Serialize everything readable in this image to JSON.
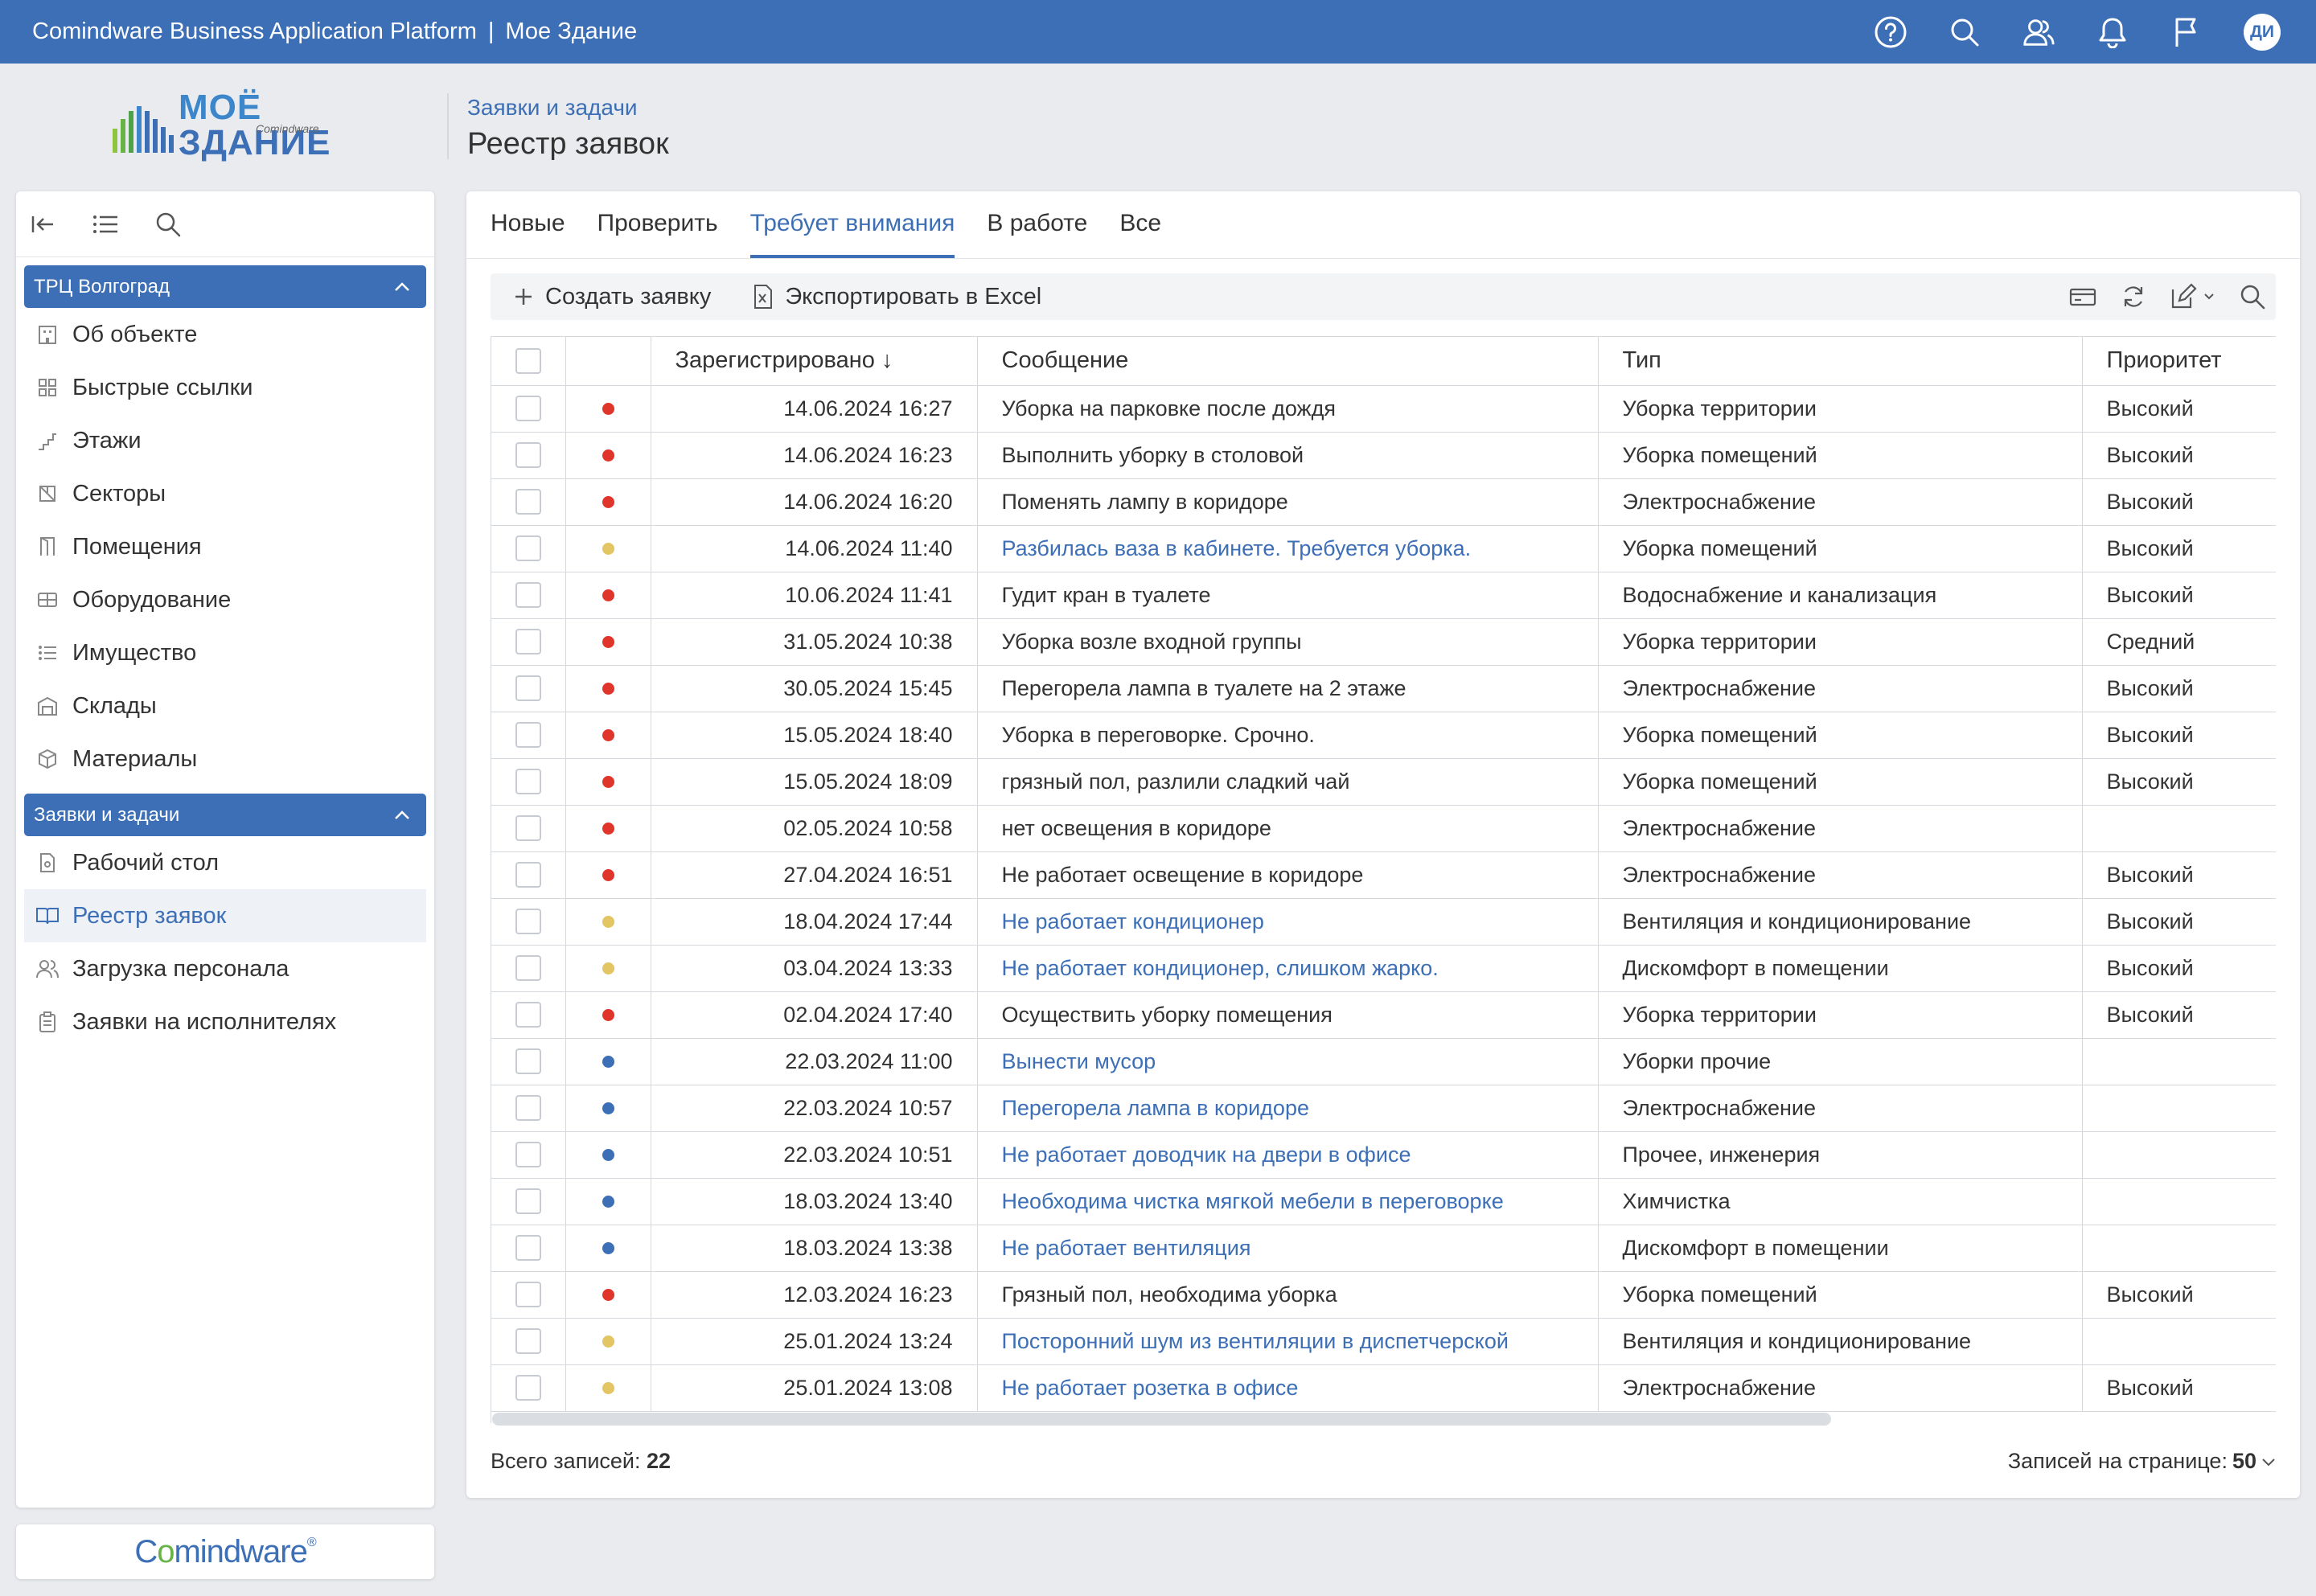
{
  "app": {
    "platform": "Comindware Business Application Platform",
    "separator": "|",
    "app_name": "Мое Здание"
  },
  "logo": {
    "line1": "МОЁ",
    "line2": "ЗДАНИЕ",
    "brand": "Comindware"
  },
  "header": {
    "breadcrumb": "Заявки и задачи",
    "title": "Реестр заявок"
  },
  "topbar": {
    "avatar_initials": "ДИ",
    "icons": [
      "help-icon",
      "search-icon",
      "users-icon",
      "bell-icon",
      "flag-icon"
    ]
  },
  "sidebar": {
    "group1": {
      "label": "ТРЦ Волгоград",
      "items": [
        {
          "label": "Об объекте",
          "icon": "building-icon"
        },
        {
          "label": "Быстрые ссылки",
          "icon": "grid-icon"
        },
        {
          "label": "Этажи",
          "icon": "stairs-icon"
        },
        {
          "label": "Секторы",
          "icon": "sectors-icon"
        },
        {
          "label": "Помещения",
          "icon": "door-icon"
        },
        {
          "label": "Оборудование",
          "icon": "equipment-icon"
        },
        {
          "label": "Имущество",
          "icon": "list-icon"
        },
        {
          "label": "Склады",
          "icon": "warehouse-icon"
        },
        {
          "label": "Материалы",
          "icon": "box-icon"
        }
      ]
    },
    "group2": {
      "label": "Заявки и задачи",
      "items": [
        {
          "label": "Рабочий стол",
          "icon": "document-icon"
        },
        {
          "label": "Реестр заявок",
          "icon": "book-icon",
          "active": true
        },
        {
          "label": "Загрузка персонала",
          "icon": "people-icon"
        },
        {
          "label": "Заявки на исполнителях",
          "icon": "clipboard-icon"
        }
      ]
    }
  },
  "footer_logo": {
    "text1": "C",
    "text2": "o",
    "text3": "mindware",
    "mark": "®"
  },
  "tabs": [
    "Новые",
    "Проверить",
    "Требует внимания",
    "В работе",
    "Все"
  ],
  "active_tab": "Требует внимания",
  "toolbar": {
    "create": "Создать заявку",
    "export": "Экспортировать в Excel"
  },
  "table": {
    "columns": [
      "",
      "",
      "Зарегистрировано ↓",
      "Сообщение",
      "Тип",
      "Приоритет"
    ],
    "rows": [
      {
        "status": "red",
        "date": "14.06.2024 16:27",
        "message": "Уборка на парковке после дождя",
        "type": "Уборка территории",
        "priority": "Высокий",
        "link": false
      },
      {
        "status": "red",
        "date": "14.06.2024 16:23",
        "message": "Выполнить уборку в столовой",
        "type": "Уборка помещений",
        "priority": "Высокий",
        "link": false
      },
      {
        "status": "red",
        "date": "14.06.2024 16:20",
        "message": "Поменять лампу в коридоре",
        "type": "Электроснабжение",
        "priority": "Высокий",
        "link": false
      },
      {
        "status": "yellow",
        "date": "14.06.2024 11:40",
        "message": "Разбилась ваза в кабинете. Требуется уборка.",
        "type": "Уборка помещений",
        "priority": "Высокий",
        "link": true
      },
      {
        "status": "red",
        "date": "10.06.2024 11:41",
        "message": "Гудит кран в туалете",
        "type": "Водоснабжение и канализация",
        "priority": "Высокий",
        "link": false
      },
      {
        "status": "red",
        "date": "31.05.2024 10:38",
        "message": "Уборка возле входной группы",
        "type": "Уборка территории",
        "priority": "Средний",
        "link": false
      },
      {
        "status": "red",
        "date": "30.05.2024 15:45",
        "message": "Перегорела лампа в туалете на 2 этаже",
        "type": "Электроснабжение",
        "priority": "Высокий",
        "link": false
      },
      {
        "status": "red",
        "date": "15.05.2024 18:40",
        "message": "Уборка в переговорке. Срочно.",
        "type": "Уборка помещений",
        "priority": "Высокий",
        "link": false
      },
      {
        "status": "red",
        "date": "15.05.2024 18:09",
        "message": "грязный пол, разлили сладкий чай",
        "type": "Уборка помещений",
        "priority": "Высокий",
        "link": false
      },
      {
        "status": "red",
        "date": "02.05.2024 10:58",
        "message": "нет освещения в коридоре",
        "type": "Электроснабжение",
        "priority": "",
        "link": false
      },
      {
        "status": "red",
        "date": "27.04.2024 16:51",
        "message": "Не работает освещение в коридоре",
        "type": "Электроснабжение",
        "priority": "Высокий",
        "link": false
      },
      {
        "status": "yellow",
        "date": "18.04.2024 17:44",
        "message": "Не работает кондиционер",
        "type": "Вентиляция и кондиционирование",
        "priority": "Высокий",
        "link": true
      },
      {
        "status": "yellow",
        "date": "03.04.2024 13:33",
        "message": "Не работает кондиционер, слишком жарко.",
        "type": "Дискомфорт в помещении",
        "priority": "Высокий",
        "link": true
      },
      {
        "status": "red",
        "date": "02.04.2024 17:40",
        "message": "Осуществить уборку помещения",
        "type": "Уборка территории",
        "priority": "Высокий",
        "link": false
      },
      {
        "status": "blue",
        "date": "22.03.2024 11:00",
        "message": "Вынести мусор",
        "type": "Уборки прочие",
        "priority": "",
        "link": true
      },
      {
        "status": "blue",
        "date": "22.03.2024 10:57",
        "message": "Перегорела лампа в коридоре",
        "type": "Электроснабжение",
        "priority": "",
        "link": true
      },
      {
        "status": "blue",
        "date": "22.03.2024 10:51",
        "message": "Не работает доводчик на двери в офисе",
        "type": "Прочее, инженерия",
        "priority": "",
        "link": true
      },
      {
        "status": "blue",
        "date": "18.03.2024 13:40",
        "message": "Необходима чистка мягкой мебели в переговорке",
        "type": "Химчистка",
        "priority": "",
        "link": true
      },
      {
        "status": "blue",
        "date": "18.03.2024 13:38",
        "message": "Не работает вентиляция",
        "type": "Дискомфорт в помещении",
        "priority": "",
        "link": true
      },
      {
        "status": "red",
        "date": "12.03.2024 16:23",
        "message": "Грязный пол, необходима уборка",
        "type": "Уборка помещений",
        "priority": "Высокий",
        "link": false
      },
      {
        "status": "yellow",
        "date": "25.01.2024 13:24",
        "message": "Посторонний шум из вентиляции в диспетчерской",
        "type": "Вентиляция и кондиционирование",
        "priority": "",
        "link": true
      },
      {
        "status": "yellow",
        "date": "25.01.2024 13:08",
        "message": "Не работает розетка в офисе",
        "type": "Электроснабжение",
        "priority": "Высокий",
        "link": true
      }
    ]
  },
  "footer": {
    "total_label": "Всего записей:",
    "total": "22",
    "per_page_label": "Записей на странице:",
    "per_page": "50"
  },
  "colors": {
    "accent": "#3c6fb6",
    "red": "#e0352b",
    "yellow": "#e3c563",
    "blue": "#3c6fb6",
    "logo_green": "#67b346"
  }
}
